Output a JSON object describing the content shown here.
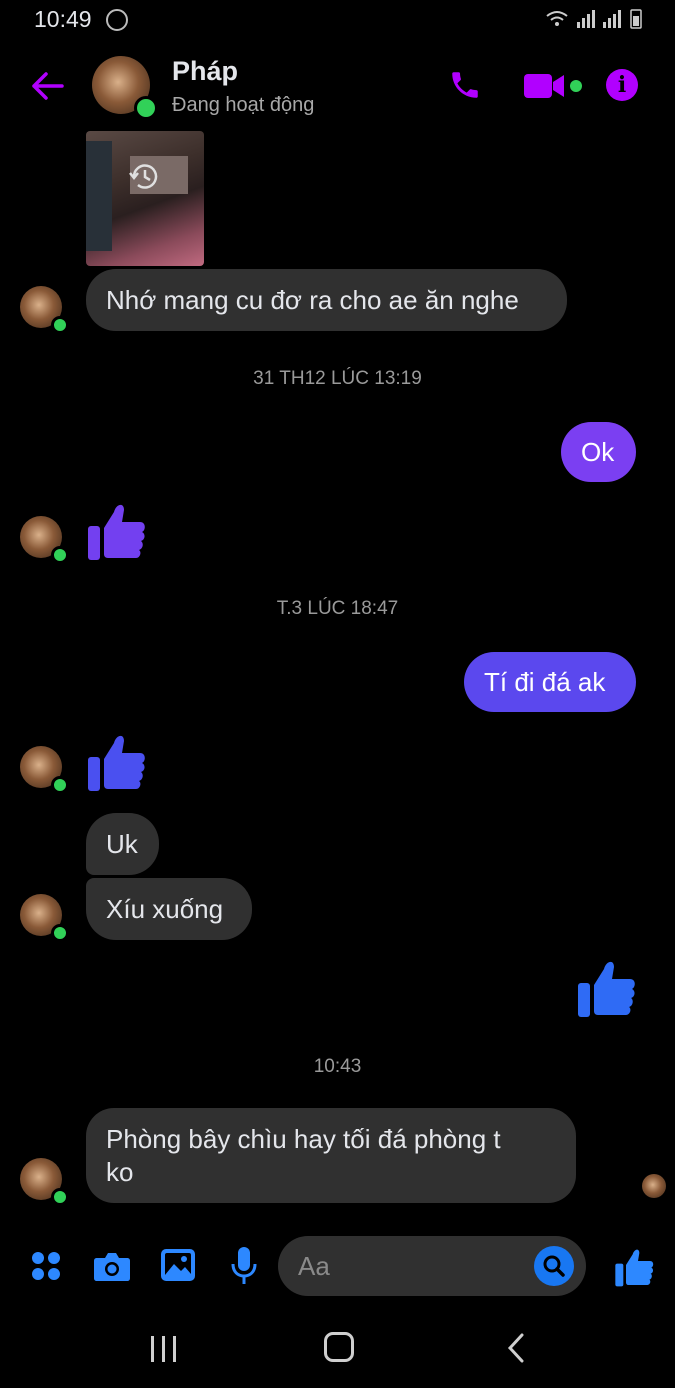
{
  "status_bar": {
    "time": "10:49"
  },
  "header": {
    "name": "Pháp",
    "status": "Đang hoạt động"
  },
  "colors": {
    "accent": "#b100ff",
    "bubble_out": "#7b3ff2",
    "like_blue": "#1877f2",
    "online": "#31d158"
  },
  "messages": {
    "m1": "Nhớ mang cu đơ ra cho ae ăn nghe",
    "ts1": "31 TH12 LÚC 13:19",
    "m2": "Ok",
    "ts2": "T.3 LÚC 18:47",
    "m3": "Tí đi đá ak",
    "m4": "Uk",
    "m5": "Xíu xuống",
    "ts3": "10:43",
    "m6_line1": "Phòng bây chìu hay tối đá phòng t",
    "m6_line2": "ko"
  },
  "composer": {
    "placeholder": "Aa"
  },
  "icons": [
    "back-arrow-icon",
    "phone-icon",
    "video-icon",
    "info-icon",
    "history-icon",
    "thumbs-up-icon",
    "apps-icon",
    "camera-icon",
    "gallery-icon",
    "mic-icon",
    "search-icon",
    "like-icon"
  ]
}
